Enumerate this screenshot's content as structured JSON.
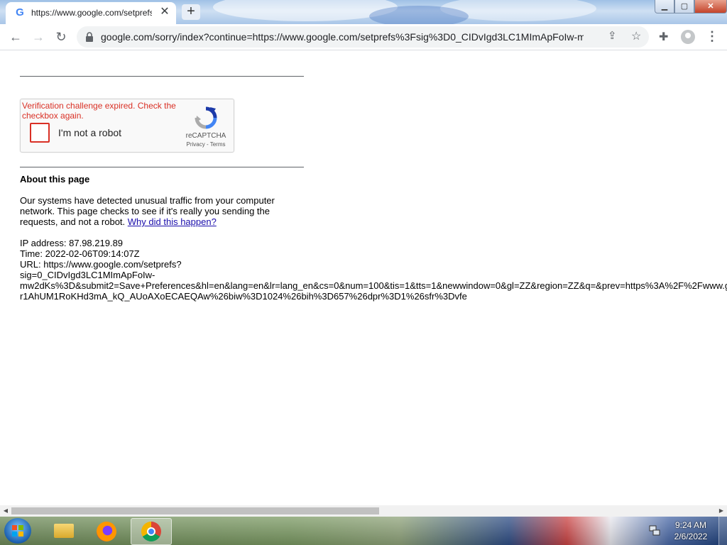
{
  "browser": {
    "tab_title": "https://www.google.com/setprefs",
    "tab_close": "✕",
    "new_tab": "+",
    "address": "google.com/sorry/index?continue=https://www.google.com/setprefs%3Fsig%3D0_CIDvIgd3LC1MImApFoIw-mw...",
    "window_buttons": {
      "minimize": "▁",
      "maximize": "▢",
      "close": "✕"
    },
    "icons": [
      "back-icon",
      "forward-icon",
      "reload-icon",
      "lock-icon",
      "share-icon",
      "star-icon",
      "extensions-icon",
      "profile-icon",
      "menu-icon"
    ]
  },
  "captcha": {
    "error": "Verification challenge expired. Check the checkbox again.",
    "checkbox_label": "I'm not a robot",
    "brand": "reCAPTCHA",
    "links": "Privacy - Terms"
  },
  "about": {
    "heading": "About this page",
    "para_text": "Our systems have detected unusual traffic from your computer network. This page checks to see if it's really you sending the requests, and not a robot.",
    "para_link": "Why did this happen?",
    "ip_line": "IP address: 87.98.219.89",
    "time_line": "Time: 2022-02-06T09:14:07Z",
    "url_line1": "URL: https://www.google.com/setprefs?",
    "url_line2": "sig=0_CIDvIgd3LC1MImApFoIw-",
    "url_line3": "mw2dKs%3D&submit2=Save+Preferences&hl=en&lang=en&lr=lang_en&cs=0&num=100&tis=1&tts=1&newwindow=0&gl=ZZ&region=ZZ&q=&prev=https%3A%2F%2Fwww.g",
    "url_line4": "r1AhUM1RoKHd3mA_kQ_AUoAXoECAEQAw%26biw%3D1024%26bih%3D657%26dpr%3D1%26sfr%3Dvfe"
  },
  "taskbar": {
    "time": "9:24 AM",
    "date": "2/6/2022",
    "apps": [
      "windows-explorer",
      "firefox",
      "chrome"
    ]
  },
  "colors": {
    "error_red": "#d93025",
    "link_blue": "#1a0dab"
  }
}
